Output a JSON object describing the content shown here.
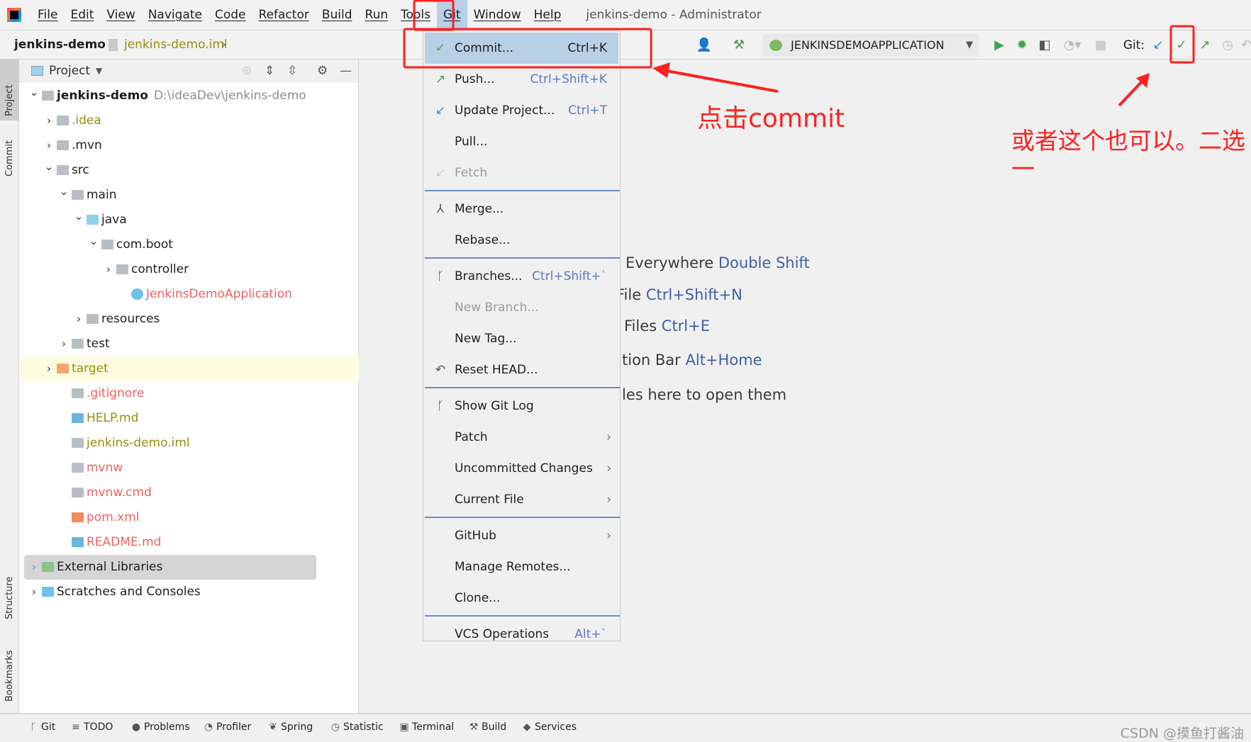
{
  "menubar": {
    "items": [
      "File",
      "Edit",
      "View",
      "Navigate",
      "Code",
      "Refactor",
      "Build",
      "Run",
      "Tools",
      "Git",
      "Window",
      "Help"
    ],
    "active": "Git",
    "window_title": "jenkins-demo - Administrator"
  },
  "navbar": {
    "project": "jenkins-demo",
    "file": "jenkins-demo.iml",
    "run_config": "JENKINSDEMOAPPLICATION",
    "git_label": "Git:"
  },
  "stripe": {
    "tabs": [
      "Project",
      "Commit",
      "Structure",
      "Bookmarks"
    ]
  },
  "project_panel": {
    "title": "Project",
    "tree": [
      {
        "label": "jenkins-demo",
        "path": "D:\\ideaDev\\jenkins-demo",
        "depth": 0,
        "chev": "open",
        "icon": "module",
        "color": "#1e1e1e",
        "bold": true
      },
      {
        "label": ".idea",
        "depth": 1,
        "chev": "closed",
        "icon": "folder",
        "color": "#9a8c0a"
      },
      {
        "label": ".mvn",
        "depth": 1,
        "chev": "closed",
        "icon": "folder",
        "color": "#1e1e1e"
      },
      {
        "label": "src",
        "depth": 1,
        "chev": "open",
        "icon": "folder",
        "color": "#1e1e1e"
      },
      {
        "label": "main",
        "depth": 2,
        "chev": "open",
        "icon": "folder",
        "color": "#1e1e1e"
      },
      {
        "label": "java",
        "depth": 3,
        "chev": "open",
        "icon": "source-folder",
        "color": "#1e1e1e"
      },
      {
        "label": "com.boot",
        "depth": 4,
        "chev": "open",
        "icon": "package",
        "color": "#1e1e1e"
      },
      {
        "label": "controller",
        "depth": 5,
        "chev": "closed",
        "icon": "package",
        "color": "#1e1e1e"
      },
      {
        "label": "JenkinsDemoApplication",
        "depth": 6,
        "chev": "none",
        "icon": "spring-class",
        "color": "#f06060"
      },
      {
        "label": "resources",
        "depth": 3,
        "chev": "closed",
        "icon": "resources-folder",
        "color": "#1e1e1e"
      },
      {
        "label": "test",
        "depth": 2,
        "chev": "closed",
        "icon": "folder",
        "color": "#1e1e1e"
      },
      {
        "label": "target",
        "depth": 1,
        "chev": "closed",
        "icon": "excluded-folder",
        "color": "#9a8c0a",
        "highlight": "#fdfce0"
      },
      {
        "label": ".gitignore",
        "depth": 2,
        "chev": "none",
        "icon": "ignore-file",
        "color": "#f06060"
      },
      {
        "label": "HELP.md",
        "depth": 2,
        "chev": "none",
        "icon": "markdown-file",
        "color": "#9a8c0a"
      },
      {
        "label": "jenkins-demo.iml",
        "depth": 2,
        "chev": "none",
        "icon": "iml-file",
        "color": "#9a8c0a"
      },
      {
        "label": "mvnw",
        "depth": 2,
        "chev": "none",
        "icon": "shell-file",
        "color": "#f06060"
      },
      {
        "label": "mvnw.cmd",
        "depth": 2,
        "chev": "none",
        "icon": "text-file",
        "color": "#f06060"
      },
      {
        "label": "pom.xml",
        "depth": 2,
        "chev": "none",
        "icon": "xml-file",
        "color": "#f06060"
      },
      {
        "label": "README.md",
        "depth": 2,
        "chev": "none",
        "icon": "markdown-file",
        "color": "#f06060"
      },
      {
        "label": "External Libraries",
        "depth": 0,
        "chev": "closed",
        "icon": "libraries",
        "color": "#1e1e1e",
        "selected": true
      },
      {
        "label": "Scratches and Consoles",
        "depth": 0,
        "chev": "closed",
        "icon": "scratches",
        "color": "#1e1e1e"
      }
    ]
  },
  "editor": {
    "hints": [
      {
        "text": "Everywhere",
        "key": "Double Shift"
      },
      {
        "text": "File",
        "key": "Ctrl+Shift+N"
      },
      {
        "text": "Files",
        "key": "Ctrl+E"
      },
      {
        "text": "tion Bar",
        "key": "Alt+Home"
      },
      {
        "text": "les here to open them",
        "key": ""
      }
    ]
  },
  "git_menu": [
    {
      "label": "Commit...",
      "shortcut": "Ctrl+K",
      "icon": "check-icon",
      "highlight": true
    },
    {
      "label": "Push...",
      "shortcut": "Ctrl+Shift+K",
      "icon": "push-arrow-icon"
    },
    {
      "label": "Update Project...",
      "shortcut": "Ctrl+T",
      "icon": "update-arrow-icon"
    },
    {
      "label": "Pull..."
    },
    {
      "label": "Fetch",
      "icon": "fetch-icon",
      "disabled": true
    },
    {
      "sep": true
    },
    {
      "label": "Merge...",
      "icon": "merge-icon"
    },
    {
      "label": "Rebase..."
    },
    {
      "sep": true
    },
    {
      "label": "Branches...",
      "shortcut": "Ctrl+Shift+`",
      "icon": "branch-icon"
    },
    {
      "label": "New Branch...",
      "disabled": true
    },
    {
      "label": "New Tag..."
    },
    {
      "label": "Reset HEAD...",
      "icon": "reset-icon"
    },
    {
      "sep": true
    },
    {
      "label": "Show Git Log",
      "icon": "git-log-icon"
    },
    {
      "label": "Patch",
      "submenu": true
    },
    {
      "label": "Uncommitted Changes",
      "submenu": true
    },
    {
      "label": "Current File",
      "submenu": true
    },
    {
      "sep": true
    },
    {
      "label": "GitHub",
      "submenu": true
    },
    {
      "label": "Manage Remotes..."
    },
    {
      "label": "Clone..."
    },
    {
      "sep": true
    },
    {
      "label": "VCS Operations",
      "shortcut": "Alt+`"
    }
  ],
  "bottom_bar": {
    "items": [
      {
        "label": "Git",
        "icon": "branch-icon"
      },
      {
        "label": "TODO",
        "icon": "list-icon"
      },
      {
        "label": "Problems",
        "icon": "problems-icon"
      },
      {
        "label": "Profiler",
        "icon": "profiler-icon"
      },
      {
        "label": "Spring",
        "icon": "spring-icon"
      },
      {
        "label": "Statistic",
        "icon": "statistic-icon"
      },
      {
        "label": "Terminal",
        "icon": "terminal-icon"
      },
      {
        "label": "Build",
        "icon": "build-icon"
      },
      {
        "label": "Services",
        "icon": "services-icon"
      }
    ],
    "watermark": "CSDN @摸鱼打酱油"
  },
  "annotations": {
    "commit_note": "点击commit",
    "alt_note_line1": "或者这个也可以。二选",
    "alt_note_line2": "一",
    "color": "#ff2020"
  }
}
